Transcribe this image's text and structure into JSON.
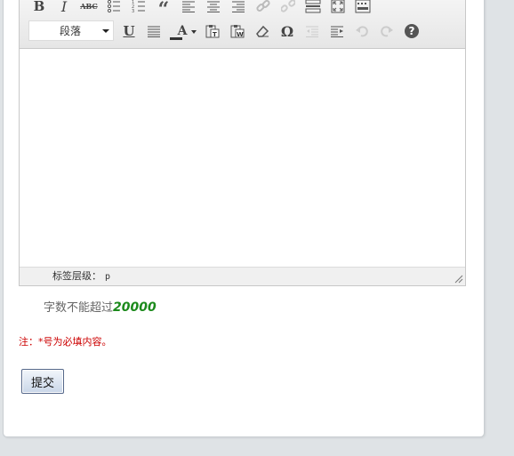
{
  "toolbar": {
    "row1": [
      "bold",
      "italic",
      "strikethrough",
      "bullet-list",
      "numbered-list",
      "blockquote",
      "align-left",
      "align-center",
      "align-right",
      "link",
      "unlink",
      "horizontal-rule",
      "fullscreen",
      "toolbar-toggle"
    ],
    "format_select_value": "段落",
    "bold_label": "B",
    "italic_label": "I",
    "strike_label": "ABC",
    "quote_label": "“",
    "underline_label": "U",
    "fontcolor_label": "A",
    "special_char_label": "Ω",
    "help_label": "?"
  },
  "statusbar": {
    "label": "标签层级：",
    "path": "p"
  },
  "limit": {
    "text": "字数不能超过",
    "value": "20000"
  },
  "note": "注：*号为必填内容。",
  "submit_label": "提交",
  "colors": {
    "note_red": "#cc0000",
    "limit_green": "#1c8a1c",
    "page_bg": "#dfe3e6"
  }
}
